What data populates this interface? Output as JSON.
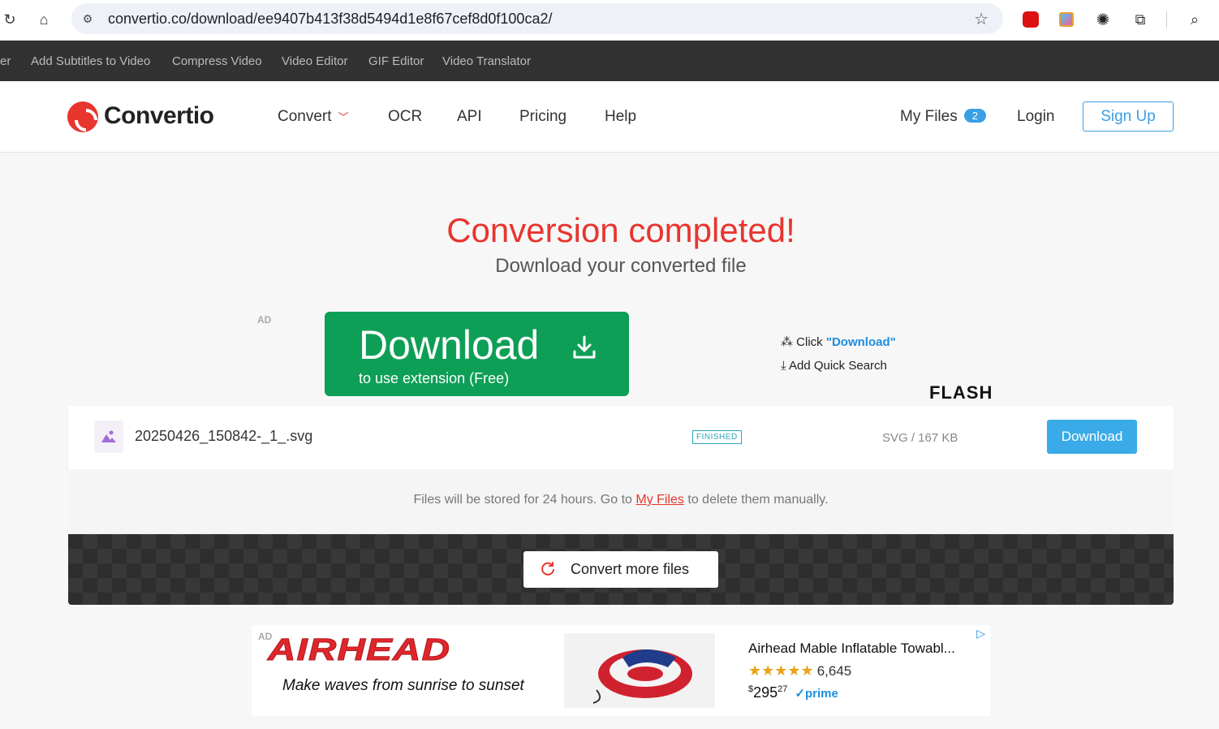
{
  "browser": {
    "url": "convertio.co/download/ee9407b413f38d5494d1e8f67cef8d0f100ca2/",
    "reload_icon": "reload-icon",
    "home_icon": "home-icon",
    "site_info_icon": "tune-icon",
    "bookmark_icon": "star-icon",
    "extensions": [
      "adblock-icon",
      "image-extension-icon",
      "gear-extension-icon",
      "puzzle-icon",
      "lens-icon"
    ]
  },
  "toolsbar": {
    "items": [
      "er",
      "Add Subtitles to Video",
      "Compress Video",
      "Video Editor",
      "GIF Editor",
      "Video Translator"
    ]
  },
  "header": {
    "logo": "Convertio",
    "nav": [
      "Convert",
      "OCR",
      "API",
      "Pricing",
      "Help"
    ],
    "my_files": "My Files",
    "my_files_count": "2",
    "login": "Login",
    "signup": "Sign Up"
  },
  "hero": {
    "title": "Conversion completed!",
    "subtitle": "Download your converted file"
  },
  "ad_top": {
    "ad_label": "AD",
    "button_big": "Download",
    "button_small": "to use extension (Free)",
    "step1_prefix": "Click ",
    "step1_highlight": "\"Download\"",
    "step2": "Add Quick Search",
    "flash": "FLASH"
  },
  "file": {
    "name": "20250426_150842-_1_.svg",
    "status": "FINISHED",
    "size": "SVG / 167 KB",
    "download": "Download"
  },
  "storage": {
    "prefix": "Files will be stored for 24 hours. Go to ",
    "link": "My Files",
    "suffix": " to delete them manually."
  },
  "convert_more": "Convert more files",
  "ad_bottom": {
    "ad_label": "AD",
    "brand": "AIRHEAD",
    "tagline": "Make waves from sunrise to sunset",
    "product_title": "Airhead Mable Inflatable Towabl...",
    "stars": "★★★★★",
    "rating": 4.5,
    "reviews": "6,645",
    "price_symbol": "$",
    "price_whole": "295",
    "price_cents": "27",
    "prime": "prime"
  },
  "colors": {
    "brand_red": "#e8352e",
    "ad_green": "#0e9f56",
    "accent_blue": "#3aabe8",
    "toolbar_dark": "#323232"
  }
}
